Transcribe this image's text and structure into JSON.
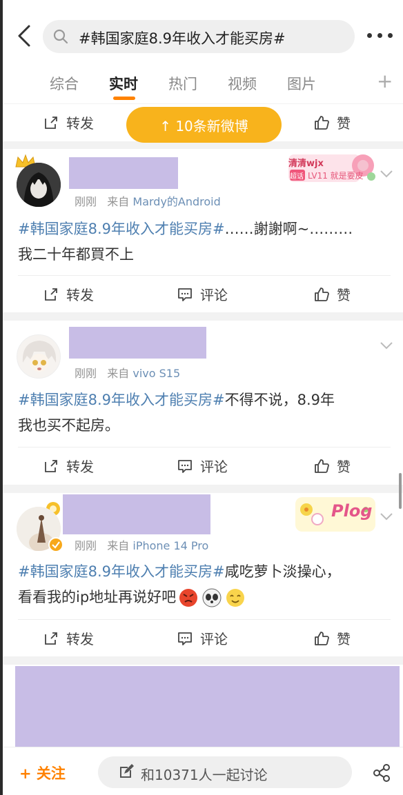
{
  "search": {
    "query": "#韩国家庭8.9年收入才能买房#"
  },
  "tabs": [
    {
      "label": "综合"
    },
    {
      "label": "实时"
    },
    {
      "label": "热门"
    },
    {
      "label": "视频"
    },
    {
      "label": "图片"
    }
  ],
  "tabs_plus": "+",
  "actions": {
    "repost": "转发",
    "comment": "评论",
    "like": "赞"
  },
  "new_posts_label": "↑ 10条新微博",
  "badge1": {
    "line1": "清清wjx",
    "tag": "超话",
    "line2": "LV11 就是要皮"
  },
  "badge2": {
    "text": "Plog"
  },
  "posts": [
    {
      "time": "刚刚",
      "from_label": "来自",
      "source": "Mardy的Android",
      "hashtag": "#韩国家庭8.9年收入才能买房#",
      "text_line1_rest": "……謝謝啊~………",
      "text_line2": "我二十年都買不上"
    },
    {
      "time": "刚刚",
      "from_label": "来自",
      "source": "vivo S15",
      "hashtag": "#韩国家庭8.9年收入才能买房#",
      "text_line1_rest": "不得不说，8.9年",
      "text_line2": "我也买不起房。"
    },
    {
      "time": "刚刚",
      "from_label": "来自",
      "source": "iPhone 14 Pro",
      "hashtag": "#韩国家庭8.9年收入才能买房#",
      "text_line1_rest": "咸吃萝卜淡操心，",
      "text_line2": "看看我的ip地址再说好吧"
    }
  ],
  "bottom": {
    "follow_label": "+ 关注",
    "discuss_label": "和10371人一起讨论"
  },
  "colors": {
    "accent": "#ff8200",
    "hashtag": "#4e7fb0",
    "redaction": "#c8bde6",
    "new_posts_bg": "#f8b31c"
  }
}
